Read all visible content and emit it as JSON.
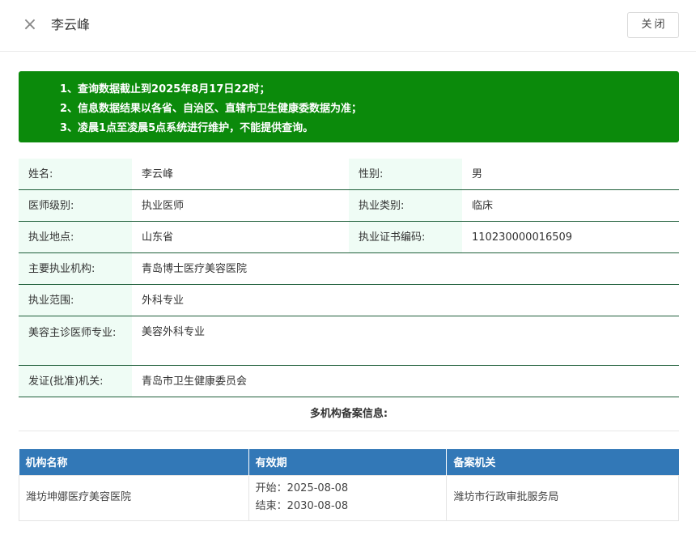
{
  "header": {
    "close_icon": "×",
    "title": "李云峰",
    "close_button": "关闭"
  },
  "notice": {
    "lines": [
      "1、查询数据截止到2025年8月17日22时；",
      "2、信息数据结果以各省、自治区、直辖市卫生健康委数据为准；",
      "3、凌晨1点至凌晨5点系统进行维护，不能提供查询。"
    ],
    "background": "#0b8a0b"
  },
  "info": {
    "name_label": "姓名:",
    "name_value": "李云峰",
    "gender_label": "性别:",
    "gender_value": "男",
    "level_label": "医师级别:",
    "level_value": "执业医师",
    "category_label": "执业类别:",
    "category_value": "临床",
    "location_label": "执业地点:",
    "location_value": "山东省",
    "cert_label": "执业证书编码:",
    "cert_value": "110230000016509",
    "institution_label": "主要执业机构:",
    "institution_value": "青岛博士医疗美容医院",
    "scope_label": "执业范围:",
    "scope_value": "外科专业",
    "cosmetic_label": "美容主诊医师专业:",
    "cosmetic_value": "美容外科专业",
    "issuer_label": "发证(批准)机关:",
    "issuer_value": "青岛市卫生健康委员会"
  },
  "multi": {
    "title": "多机构备案信息:"
  },
  "registration": {
    "columns": [
      "机构名称",
      "有效期",
      "备案机关"
    ],
    "rows": [
      {
        "institution": "潍坊坤娜医疗美容医院",
        "start": "开始：2025-08-08",
        "end": "结束：2030-08-08",
        "authority": "潍坊市行政审批服务局"
      }
    ],
    "header_color": "#3278b7"
  }
}
